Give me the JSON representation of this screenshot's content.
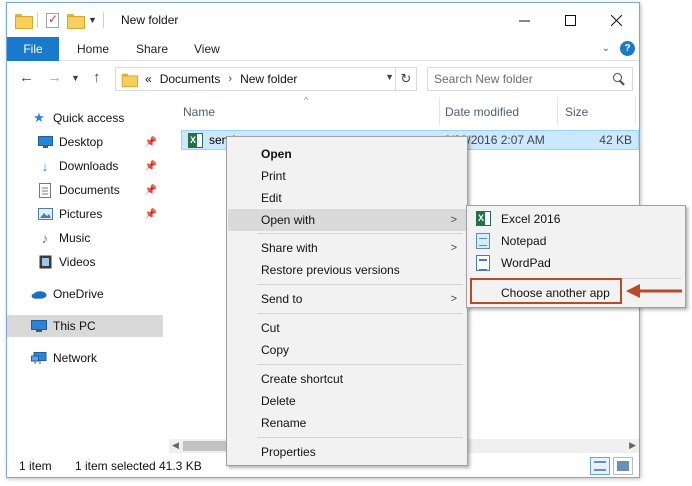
{
  "window": {
    "title": "New folder"
  },
  "ribbon": {
    "tabs": [
      "File",
      "Home",
      "Share",
      "View"
    ],
    "help_glyph": "?"
  },
  "address": {
    "overflow": "«",
    "crumbs": [
      "Documents",
      "New folder"
    ]
  },
  "search": {
    "placeholder": "Search New folder"
  },
  "nav": {
    "items": [
      {
        "label": "Quick access",
        "icon": "star-icon"
      },
      {
        "label": "Desktop",
        "icon": "desktop-icon"
      },
      {
        "label": "Downloads",
        "icon": "download-icon"
      },
      {
        "label": "Documents",
        "icon": "document-icon"
      },
      {
        "label": "Pictures",
        "icon": "picture-icon"
      },
      {
        "label": "Music",
        "icon": "music-icon"
      },
      {
        "label": "Videos",
        "icon": "video-icon"
      },
      {
        "label": "OneDrive",
        "icon": "cloud-icon"
      },
      {
        "label": "This PC",
        "icon": "computer-icon"
      },
      {
        "label": "Network",
        "icon": "network-icon"
      }
    ]
  },
  "columns": {
    "name": "Name",
    "date": "Date modified",
    "size": "Size"
  },
  "file": {
    "name": "send",
    "date": "6/30/2016 2:07 AM",
    "size": "42 KB"
  },
  "status": {
    "count": "1 item",
    "selected": "1 item selected",
    "size": "41.3 KB"
  },
  "context_menu": {
    "open": "Open",
    "print": "Print",
    "edit": "Edit",
    "open_with": "Open with",
    "share_with": "Share with",
    "restore": "Restore previous versions",
    "send_to": "Send to",
    "cut": "Cut",
    "copy": "Copy",
    "create_shortcut": "Create shortcut",
    "delete": "Delete",
    "rename": "Rename",
    "properties": "Properties"
  },
  "open_with_submenu": {
    "excel": "Excel 2016",
    "notepad": "Notepad",
    "wordpad": "WordPad",
    "choose": "Choose another app"
  },
  "colors": {
    "accent": "#1979ca",
    "selection": "#cce8ff",
    "highlight_box": "#b84a2a"
  }
}
